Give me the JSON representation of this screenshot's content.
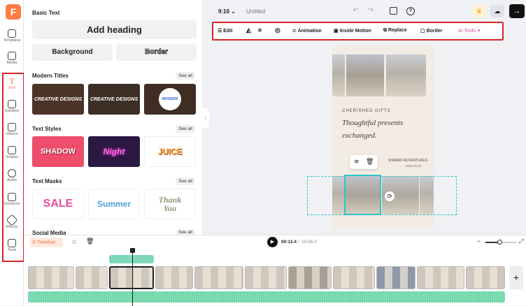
{
  "app": {
    "logo": "F",
    "title": "Untitled",
    "aspect": "9:16"
  },
  "rail": [
    {
      "label": "Templates",
      "icon": "templates-icon"
    },
    {
      "label": "Media",
      "icon": "media-icon"
    },
    {
      "label": "Text",
      "icon": "text-icon",
      "active": true
    },
    {
      "label": "Subtitles",
      "icon": "subtitles-icon"
    },
    {
      "label": "Videos",
      "icon": "videos-icon"
    },
    {
      "label": "Images",
      "icon": "images-icon"
    },
    {
      "label": "Audio",
      "icon": "audio-icon"
    },
    {
      "label": "Elements",
      "icon": "elements-icon"
    },
    {
      "label": "Effects",
      "icon": "effects-icon"
    },
    {
      "label": "Tools",
      "icon": "tools-icon"
    }
  ],
  "panel": {
    "basic_text": "Basic Text",
    "add_heading": "Add heading",
    "background": "Background",
    "border": "Border",
    "modern_titles": "Modern Titles",
    "text_styles": "Text Styles",
    "text_masks": "Text Masks",
    "social_media": "Social Media",
    "see_all": "See all",
    "modern_tiles": [
      "CREATIVE DESIGNS",
      "CREATIVE DESIGNS",
      "MODERN"
    ],
    "style_tiles": [
      "SHADOW",
      "Night",
      "JUICE"
    ],
    "mask_tiles": [
      "SALE",
      "Summer",
      "Thank You"
    ]
  },
  "toolbar": {
    "edit": "Edit",
    "animation": "Animation",
    "inside_motion": "Inside Motion",
    "replace": "Replace",
    "border": "Border",
    "ai_tools": "AI Tools"
  },
  "canvas": {
    "heading": "CHERISHED GIFTS",
    "script1": "Thoughtful presents",
    "script2": "exchanged.",
    "tag": "SHARED ADVENTURES",
    "date": "2023.06.31"
  },
  "timeline": {
    "label": "Timeline",
    "current": "00:12.4",
    "total": "00:56.0",
    "add": "+"
  },
  "colors": {
    "accent": "#ff6a3a",
    "highlight": "#d8232a",
    "audio": "#6fd6a8",
    "selection": "#2dc6c6"
  }
}
